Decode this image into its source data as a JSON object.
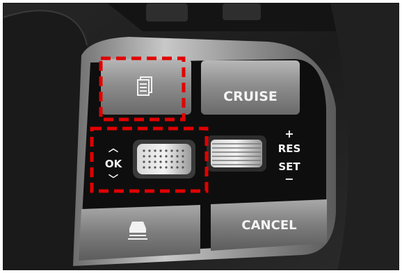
{
  "buttons": {
    "mode_icon": "document-icon",
    "cruise_label": "CRUISE",
    "ok_label": "OK",
    "res_label": "RES",
    "res_sign": "+",
    "set_label": "SET",
    "set_sign": "−",
    "lane_icon": "lane-assist-icon",
    "cancel_label": "CANCEL"
  },
  "highlight_color": "#e10000"
}
